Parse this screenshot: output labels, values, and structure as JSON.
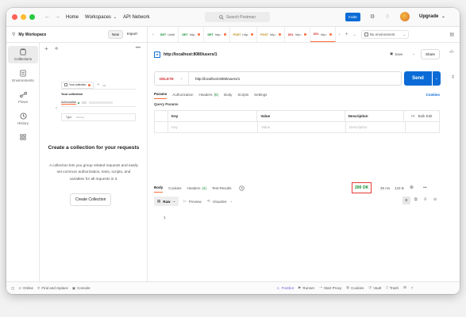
{
  "titlebar": {
    "home": "Home",
    "workspaces": "Workspaces",
    "api_network": "API Network",
    "search_placeholder": "Search Postman",
    "invite": "Invite",
    "upgrade": "Upgrade"
  },
  "workspace": {
    "name": "My Workspace",
    "new_btn": "New",
    "import_btn": "Import"
  },
  "sidebar": {
    "items": [
      {
        "label": "Collections",
        "icon": "collections-icon"
      },
      {
        "label": "Environments",
        "icon": "environments-icon"
      },
      {
        "label": "Flows",
        "icon": "flows-icon"
      },
      {
        "label": "History",
        "icon": "history-icon"
      }
    ]
  },
  "illustration": {
    "tab_label": "Your collection",
    "title": "Your collection",
    "authorization": "Authorization",
    "type": "Type",
    "type_value": "API Key"
  },
  "empty_state": {
    "heading": "Create a collection for your requests",
    "body": "A collection lets you group related requests and easily set common authorization, tests, scripts, and variables for all requests in it.",
    "button": "Create Collection"
  },
  "tabs": [
    {
      "method": "GET",
      "label": "Untitl",
      "color": "#0a8a2e"
    },
    {
      "method": "GET",
      "label": "http:",
      "color": "#0a8a2e"
    },
    {
      "method": "GET",
      "label": "http:",
      "color": "#0a8a2e"
    },
    {
      "method": "POST",
      "label": "http:",
      "color": "#b8860b"
    },
    {
      "method": "POST",
      "label": "http:",
      "color": "#b8860b"
    },
    {
      "method": "DEL",
      "label": "http:",
      "color": "#d32f2f"
    },
    {
      "method": "DEL",
      "label": "http:",
      "color": "#d32f2f"
    }
  ],
  "environment": "No environment",
  "request": {
    "title": "http://localhost:8080/users/1",
    "save": "Save",
    "share": "Share",
    "method": "DELETE",
    "url": "http://localhost:8080/users/1",
    "send": "Send",
    "cookies": "Cookies"
  },
  "req_tabs": [
    {
      "label": "Params"
    },
    {
      "label": "Authorization"
    },
    {
      "label": "Headers",
      "count": "(6)"
    },
    {
      "label": "Body"
    },
    {
      "label": "Scripts"
    },
    {
      "label": "Settings"
    }
  ],
  "query_params": {
    "title": "Query Params",
    "headers": [
      "Key",
      "Value",
      "Description"
    ],
    "bulk_edit": "Bulk Edit",
    "placeholders": [
      "Key",
      "Value",
      "Description"
    ]
  },
  "response": {
    "tabs": [
      {
        "label": "Body"
      },
      {
        "label": "Cookies"
      },
      {
        "label": "Headers",
        "count": "(4)"
      },
      {
        "label": "Test Results"
      }
    ],
    "status": "200 OK",
    "time": "35 ms",
    "size": "123 B",
    "view": "Raw",
    "preview": "Preview",
    "visualize": "Visualize",
    "line_number": "1"
  },
  "footer": {
    "online": "Online",
    "find_replace": "Find and replace",
    "console": "Console",
    "postbot": "Postbot",
    "runner": "Runner",
    "proxy": "Start Proxy",
    "cookies": "Cookies",
    "vault": "Vault",
    "trash": "Trash"
  },
  "colors": {
    "accent": "#0b6bd6",
    "postman_orange": "#ff6c37",
    "status_highlight": "#e53935",
    "status_text": "#0a8a2e"
  }
}
